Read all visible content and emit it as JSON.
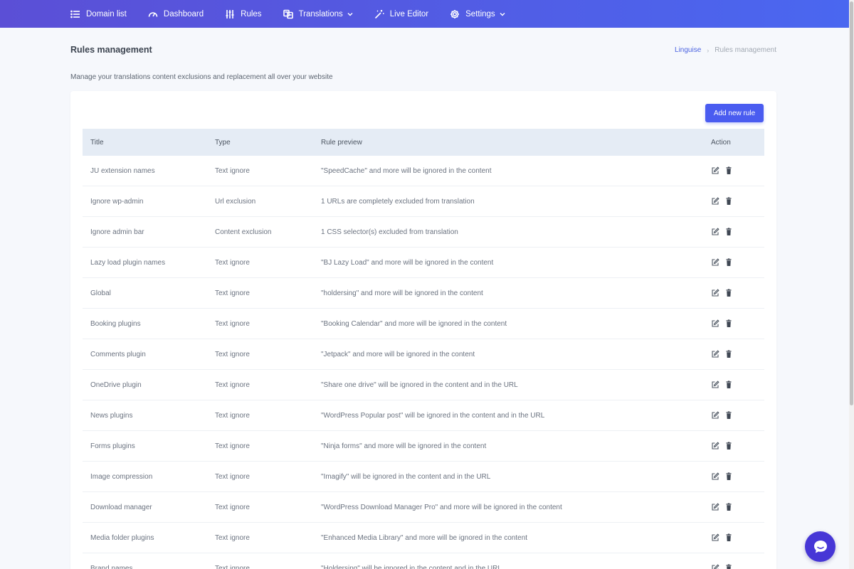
{
  "nav": {
    "items": [
      {
        "label": "Domain list",
        "icon": "list-icon",
        "dropdown": false
      },
      {
        "label": "Dashboard",
        "icon": "gauge-icon",
        "dropdown": false
      },
      {
        "label": "Rules",
        "icon": "sliders-icon",
        "dropdown": false
      },
      {
        "label": "Translations",
        "icon": "translate-icon",
        "dropdown": true
      },
      {
        "label": "Live Editor",
        "icon": "magic-wand-icon",
        "dropdown": false
      },
      {
        "label": "Settings",
        "icon": "gear-icon",
        "dropdown": true
      }
    ]
  },
  "header": {
    "title": "Rules management",
    "breadcrumb": {
      "root": "Linguise",
      "current": "Rules management"
    },
    "description": "Manage your translations content exclusions and replacement all over your website"
  },
  "toolbar": {
    "add_label": "Add new rule"
  },
  "table": {
    "columns": {
      "title": "Title",
      "type": "Type",
      "preview": "Rule preview",
      "action": "Action"
    },
    "rows": [
      {
        "title": "JU extension names",
        "type": "Text ignore",
        "preview": "\"SpeedCache\" and more will be ignored in the content"
      },
      {
        "title": "Ignore wp-admin",
        "type": "Url exclusion",
        "preview": "1 URLs are completely excluded from translation"
      },
      {
        "title": "Ignore admin bar",
        "type": "Content exclusion",
        "preview": "1 CSS selector(s) excluded from translation"
      },
      {
        "title": "Lazy load plugin names",
        "type": "Text ignore",
        "preview": "\"BJ Lazy Load\" and more will be ignored in the content"
      },
      {
        "title": "Global",
        "type": "Text ignore",
        "preview": "\"holdersing\" and more will be ignored in the content"
      },
      {
        "title": "Booking plugins",
        "type": "Text ignore",
        "preview": "\"Booking Calendar\" and more will be ignored in the content"
      },
      {
        "title": "Comments plugin",
        "type": "Text ignore",
        "preview": "\"Jetpack\" and more will be ignored in the content"
      },
      {
        "title": "OneDrive plugin",
        "type": "Text ignore",
        "preview": "\"Share one drive\" will be ignored in the content and in the URL"
      },
      {
        "title": "News plugins",
        "type": "Text ignore",
        "preview": "\"WordPress Popular post\" will be ignored in the content and in the URL"
      },
      {
        "title": "Forms plugins",
        "type": "Text ignore",
        "preview": "\"Ninja forms\" and more will be ignored in the content"
      },
      {
        "title": "Image compression",
        "type": "Text ignore",
        "preview": "\"Imagify\" will be ignored in the content and in the URL"
      },
      {
        "title": "Download manager",
        "type": "Text ignore",
        "preview": "\"WordPress Download Manager Pro\" and more will be ignored in the content"
      },
      {
        "title": "Media folder plugins",
        "type": "Text ignore",
        "preview": "\"Enhanced Media Library\" and more will be ignored in the content"
      },
      {
        "title": "Brand names",
        "type": "Text ignore",
        "preview": "\"Holdersing\" will be ignored in the content and in the URL"
      }
    ]
  },
  "colors": {
    "nav_start": "#5b4fd6",
    "nav_end": "#4a67f0",
    "accent": "#4a5cf0",
    "chat": "#4636d6"
  }
}
